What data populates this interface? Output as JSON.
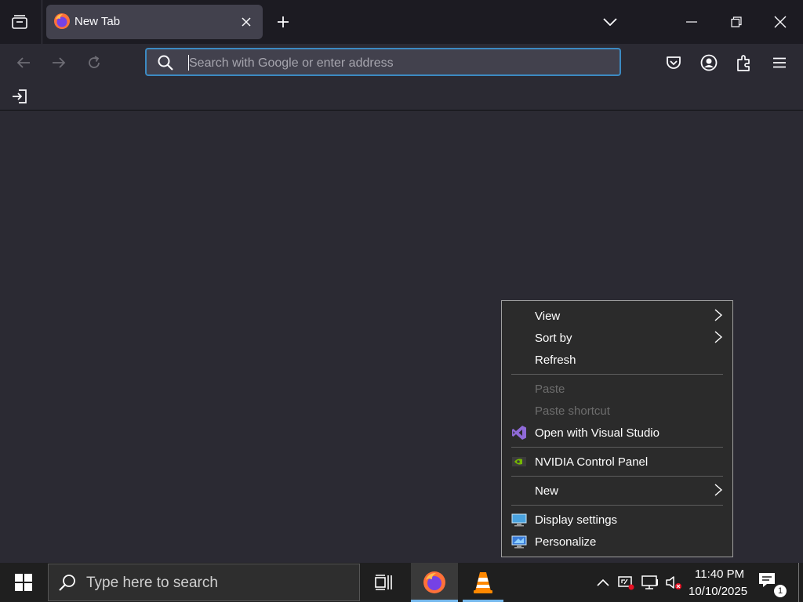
{
  "browser": {
    "tab": {
      "title": "New Tab",
      "favicon": "firefox-icon"
    },
    "address_bar": {
      "placeholder": "Search with Google or enter address",
      "value": ""
    },
    "toolbar_icons": [
      "pocket-icon",
      "account-icon",
      "extensions-icon",
      "menu-icon"
    ]
  },
  "context_menu": {
    "items": [
      {
        "label": "View",
        "submenu": true,
        "enabled": true
      },
      {
        "label": "Sort by",
        "submenu": true,
        "enabled": true
      },
      {
        "label": "Refresh",
        "submenu": false,
        "enabled": true
      },
      {
        "label": "Paste",
        "submenu": false,
        "enabled": false
      },
      {
        "label": "Paste shortcut",
        "submenu": false,
        "enabled": false
      },
      {
        "label": "Open with Visual Studio",
        "submenu": false,
        "enabled": true,
        "icon": "visual-studio-icon"
      },
      {
        "label": "NVIDIA Control Panel",
        "submenu": false,
        "enabled": true,
        "icon": "nvidia-icon"
      },
      {
        "label": "New",
        "submenu": true,
        "enabled": true
      },
      {
        "label": "Display settings",
        "submenu": false,
        "enabled": true,
        "icon": "display-settings-icon"
      },
      {
        "label": "Personalize",
        "submenu": false,
        "enabled": true,
        "icon": "personalize-icon"
      }
    ]
  },
  "taskbar": {
    "search_placeholder": "Type here to search",
    "pinned_apps": [
      "firefox-icon",
      "vlc-icon"
    ],
    "clock": {
      "time": "11:40 PM",
      "date": "10/10/2025"
    },
    "notification_count": "1"
  },
  "colors": {
    "browser_bg": "#2b2a33",
    "tabstrip_bg": "#1c1b22",
    "urlbar_focus": "#3c8ac2",
    "taskbar_bg": "#1f1f1f",
    "taskbar_active_indicator": "#76b9ed"
  }
}
